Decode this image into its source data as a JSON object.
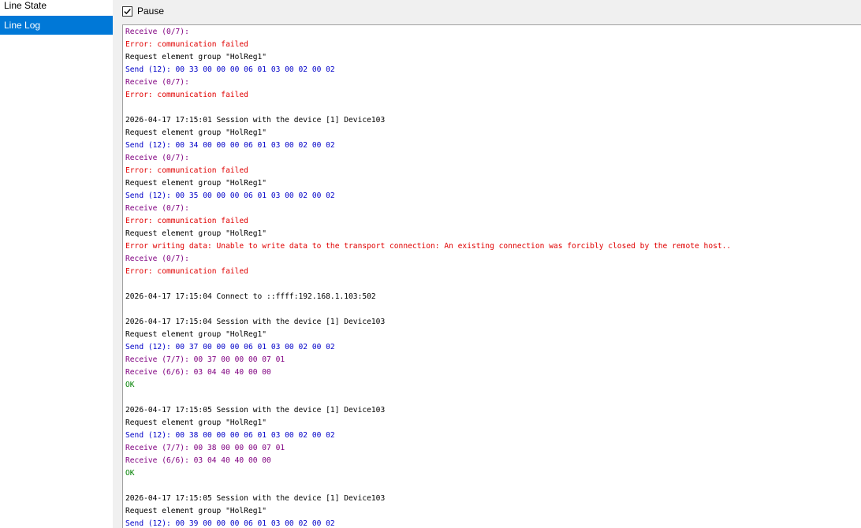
{
  "nav": {
    "items": [
      {
        "label": "Line State",
        "selected": false
      },
      {
        "label": "Line Log",
        "selected": true
      }
    ]
  },
  "toolbar": {
    "pause_label": "Pause",
    "pause_checked": true
  },
  "colors": {
    "selection": "#0078d7",
    "send": "#0000c8",
    "receive": "#800080",
    "error": "#e00000",
    "ok": "#008000",
    "info": "#000000"
  },
  "log": {
    "lines": [
      {
        "text": "Receive (0/7):",
        "kind": "receive"
      },
      {
        "text": "Error: communication failed",
        "kind": "error"
      },
      {
        "text": "Request element group \"HolReg1\"",
        "kind": "info"
      },
      {
        "text": "Send (12): 00 33 00 00 00 06 01 03 00 02 00 02",
        "kind": "send"
      },
      {
        "text": "Receive (0/7):",
        "kind": "receive"
      },
      {
        "text": "Error: communication failed",
        "kind": "error"
      },
      {
        "text": "",
        "kind": "info"
      },
      {
        "text": "2026-04-17 17:15:01 Session with the device [1] Device103",
        "kind": "info"
      },
      {
        "text": "Request element group \"HolReg1\"",
        "kind": "info"
      },
      {
        "text": "Send (12): 00 34 00 00 00 06 01 03 00 02 00 02",
        "kind": "send"
      },
      {
        "text": "Receive (0/7):",
        "kind": "receive"
      },
      {
        "text": "Error: communication failed",
        "kind": "error"
      },
      {
        "text": "Request element group \"HolReg1\"",
        "kind": "info"
      },
      {
        "text": "Send (12): 00 35 00 00 00 06 01 03 00 02 00 02",
        "kind": "send"
      },
      {
        "text": "Receive (0/7):",
        "kind": "receive"
      },
      {
        "text": "Error: communication failed",
        "kind": "error"
      },
      {
        "text": "Request element group \"HolReg1\"",
        "kind": "info"
      },
      {
        "text": "Error writing data: Unable to write data to the transport connection: An existing connection was forcibly closed by the remote host..",
        "kind": "error"
      },
      {
        "text": "Receive (0/7):",
        "kind": "receive"
      },
      {
        "text": "Error: communication failed",
        "kind": "error"
      },
      {
        "text": "",
        "kind": "info"
      },
      {
        "text": "2026-04-17 17:15:04 Connect to ::ffff:192.168.1.103:502",
        "kind": "info"
      },
      {
        "text": "",
        "kind": "info"
      },
      {
        "text": "2026-04-17 17:15:04 Session with the device [1] Device103",
        "kind": "info"
      },
      {
        "text": "Request element group \"HolReg1\"",
        "kind": "info"
      },
      {
        "text": "Send (12): 00 37 00 00 00 06 01 03 00 02 00 02",
        "kind": "send"
      },
      {
        "text": "Receive (7/7): 00 37 00 00 00 07 01",
        "kind": "receive"
      },
      {
        "text": "Receive (6/6): 03 04 40 40 00 00",
        "kind": "receive"
      },
      {
        "text": "OK",
        "kind": "ok"
      },
      {
        "text": "",
        "kind": "info"
      },
      {
        "text": "2026-04-17 17:15:05 Session with the device [1] Device103",
        "kind": "info"
      },
      {
        "text": "Request element group \"HolReg1\"",
        "kind": "info"
      },
      {
        "text": "Send (12): 00 38 00 00 00 06 01 03 00 02 00 02",
        "kind": "send"
      },
      {
        "text": "Receive (7/7): 00 38 00 00 00 07 01",
        "kind": "receive"
      },
      {
        "text": "Receive (6/6): 03 04 40 40 00 00",
        "kind": "receive"
      },
      {
        "text": "OK",
        "kind": "ok"
      },
      {
        "text": "",
        "kind": "info"
      },
      {
        "text": "2026-04-17 17:15:05 Session with the device [1] Device103",
        "kind": "info"
      },
      {
        "text": "Request element group \"HolReg1\"",
        "kind": "info"
      },
      {
        "text": "Send (12): 00 39 00 00 00 06 01 03 00 02 00 02",
        "kind": "send"
      }
    ]
  }
}
